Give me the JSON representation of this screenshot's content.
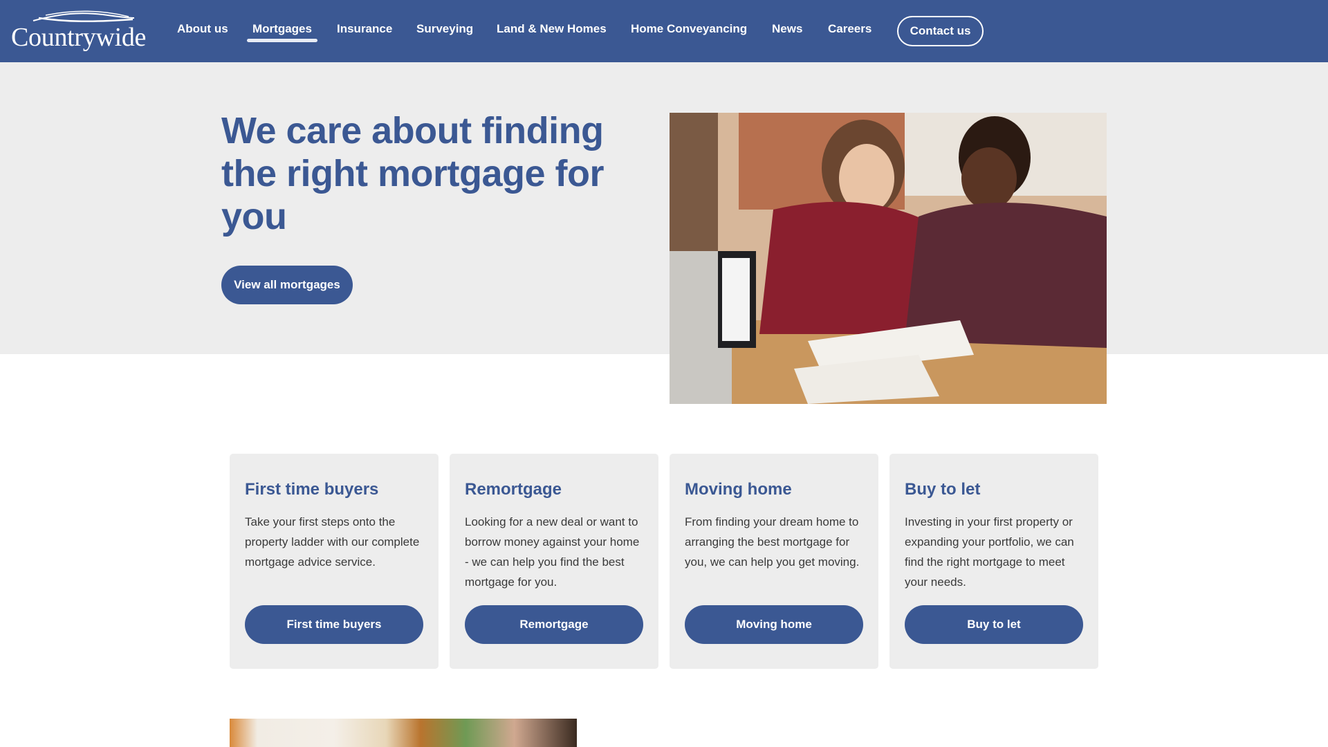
{
  "brand": {
    "name": "Countrywide",
    "primary_color": "#3b5893",
    "band_color": "#ededed"
  },
  "nav": {
    "items": [
      {
        "label": "About us",
        "active": false
      },
      {
        "label": "Mortgages",
        "active": true
      },
      {
        "label": "Insurance",
        "active": false
      },
      {
        "label": "Surveying",
        "active": false
      },
      {
        "label": "Land & New Homes",
        "active": false
      },
      {
        "label": "Home Conveyancing",
        "active": false
      },
      {
        "label": "News",
        "active": false
      },
      {
        "label": "Careers",
        "active": false
      }
    ],
    "contact_label": "Contact us"
  },
  "hero": {
    "title": "We care about finding the right mortgage for you",
    "button_label": "View all mortgages",
    "image_alt": "Couple signing mortgage documents with an adviser"
  },
  "cards": [
    {
      "title": "First time buyers",
      "text": "Take your first steps onto the property ladder with our complete mortgage advice service.",
      "button_label": "First time buyers"
    },
    {
      "title": "Remortgage",
      "text": "Looking for a new deal or want to borrow money against your home - we can help you find the best mortgage for you.",
      "button_label": "Remortgage"
    },
    {
      "title": "Moving home",
      "text": "From finding your dream home to arranging the best mortgage for you, we can help you get moving.",
      "button_label": "Moving home"
    },
    {
      "title": "Buy to let",
      "text": "Investing in your first property or expanding your portfolio, we can find the right mortgage to meet your needs.",
      "button_label": "Buy to let"
    }
  ]
}
